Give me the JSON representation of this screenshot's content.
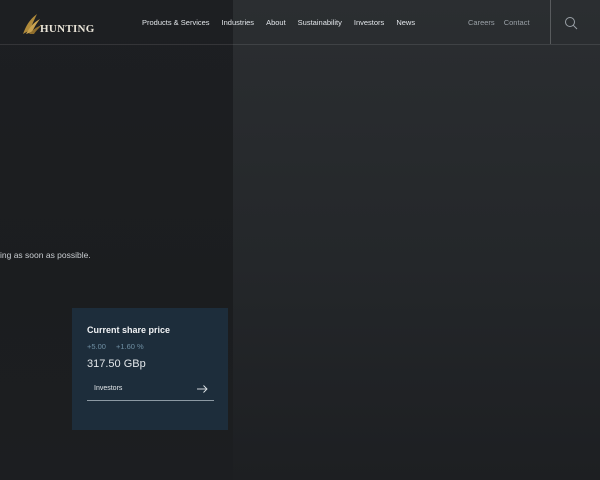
{
  "brand": {
    "name": "HUNTING",
    "logo_icon": "feather-bird-icon",
    "gold": "#b08a3a"
  },
  "nav": {
    "items": [
      {
        "label": "Products & Services"
      },
      {
        "label": "Industries"
      },
      {
        "label": "About"
      },
      {
        "label": "Sustainability"
      },
      {
        "label": "Investors"
      },
      {
        "label": "News"
      }
    ],
    "secondary": [
      {
        "label": "Careers"
      },
      {
        "label": "Contact"
      }
    ],
    "search_icon": "search-icon"
  },
  "hero": {
    "text": "ing as soon as possible."
  },
  "share_price": {
    "title": "Current share price",
    "change_abs": "+5.00",
    "change_pct": "+1.60 %",
    "price": "317.50 GBp",
    "link_label": "Investors",
    "link_icon": "arrow-right-icon",
    "card_color": "#1d2d3b"
  }
}
